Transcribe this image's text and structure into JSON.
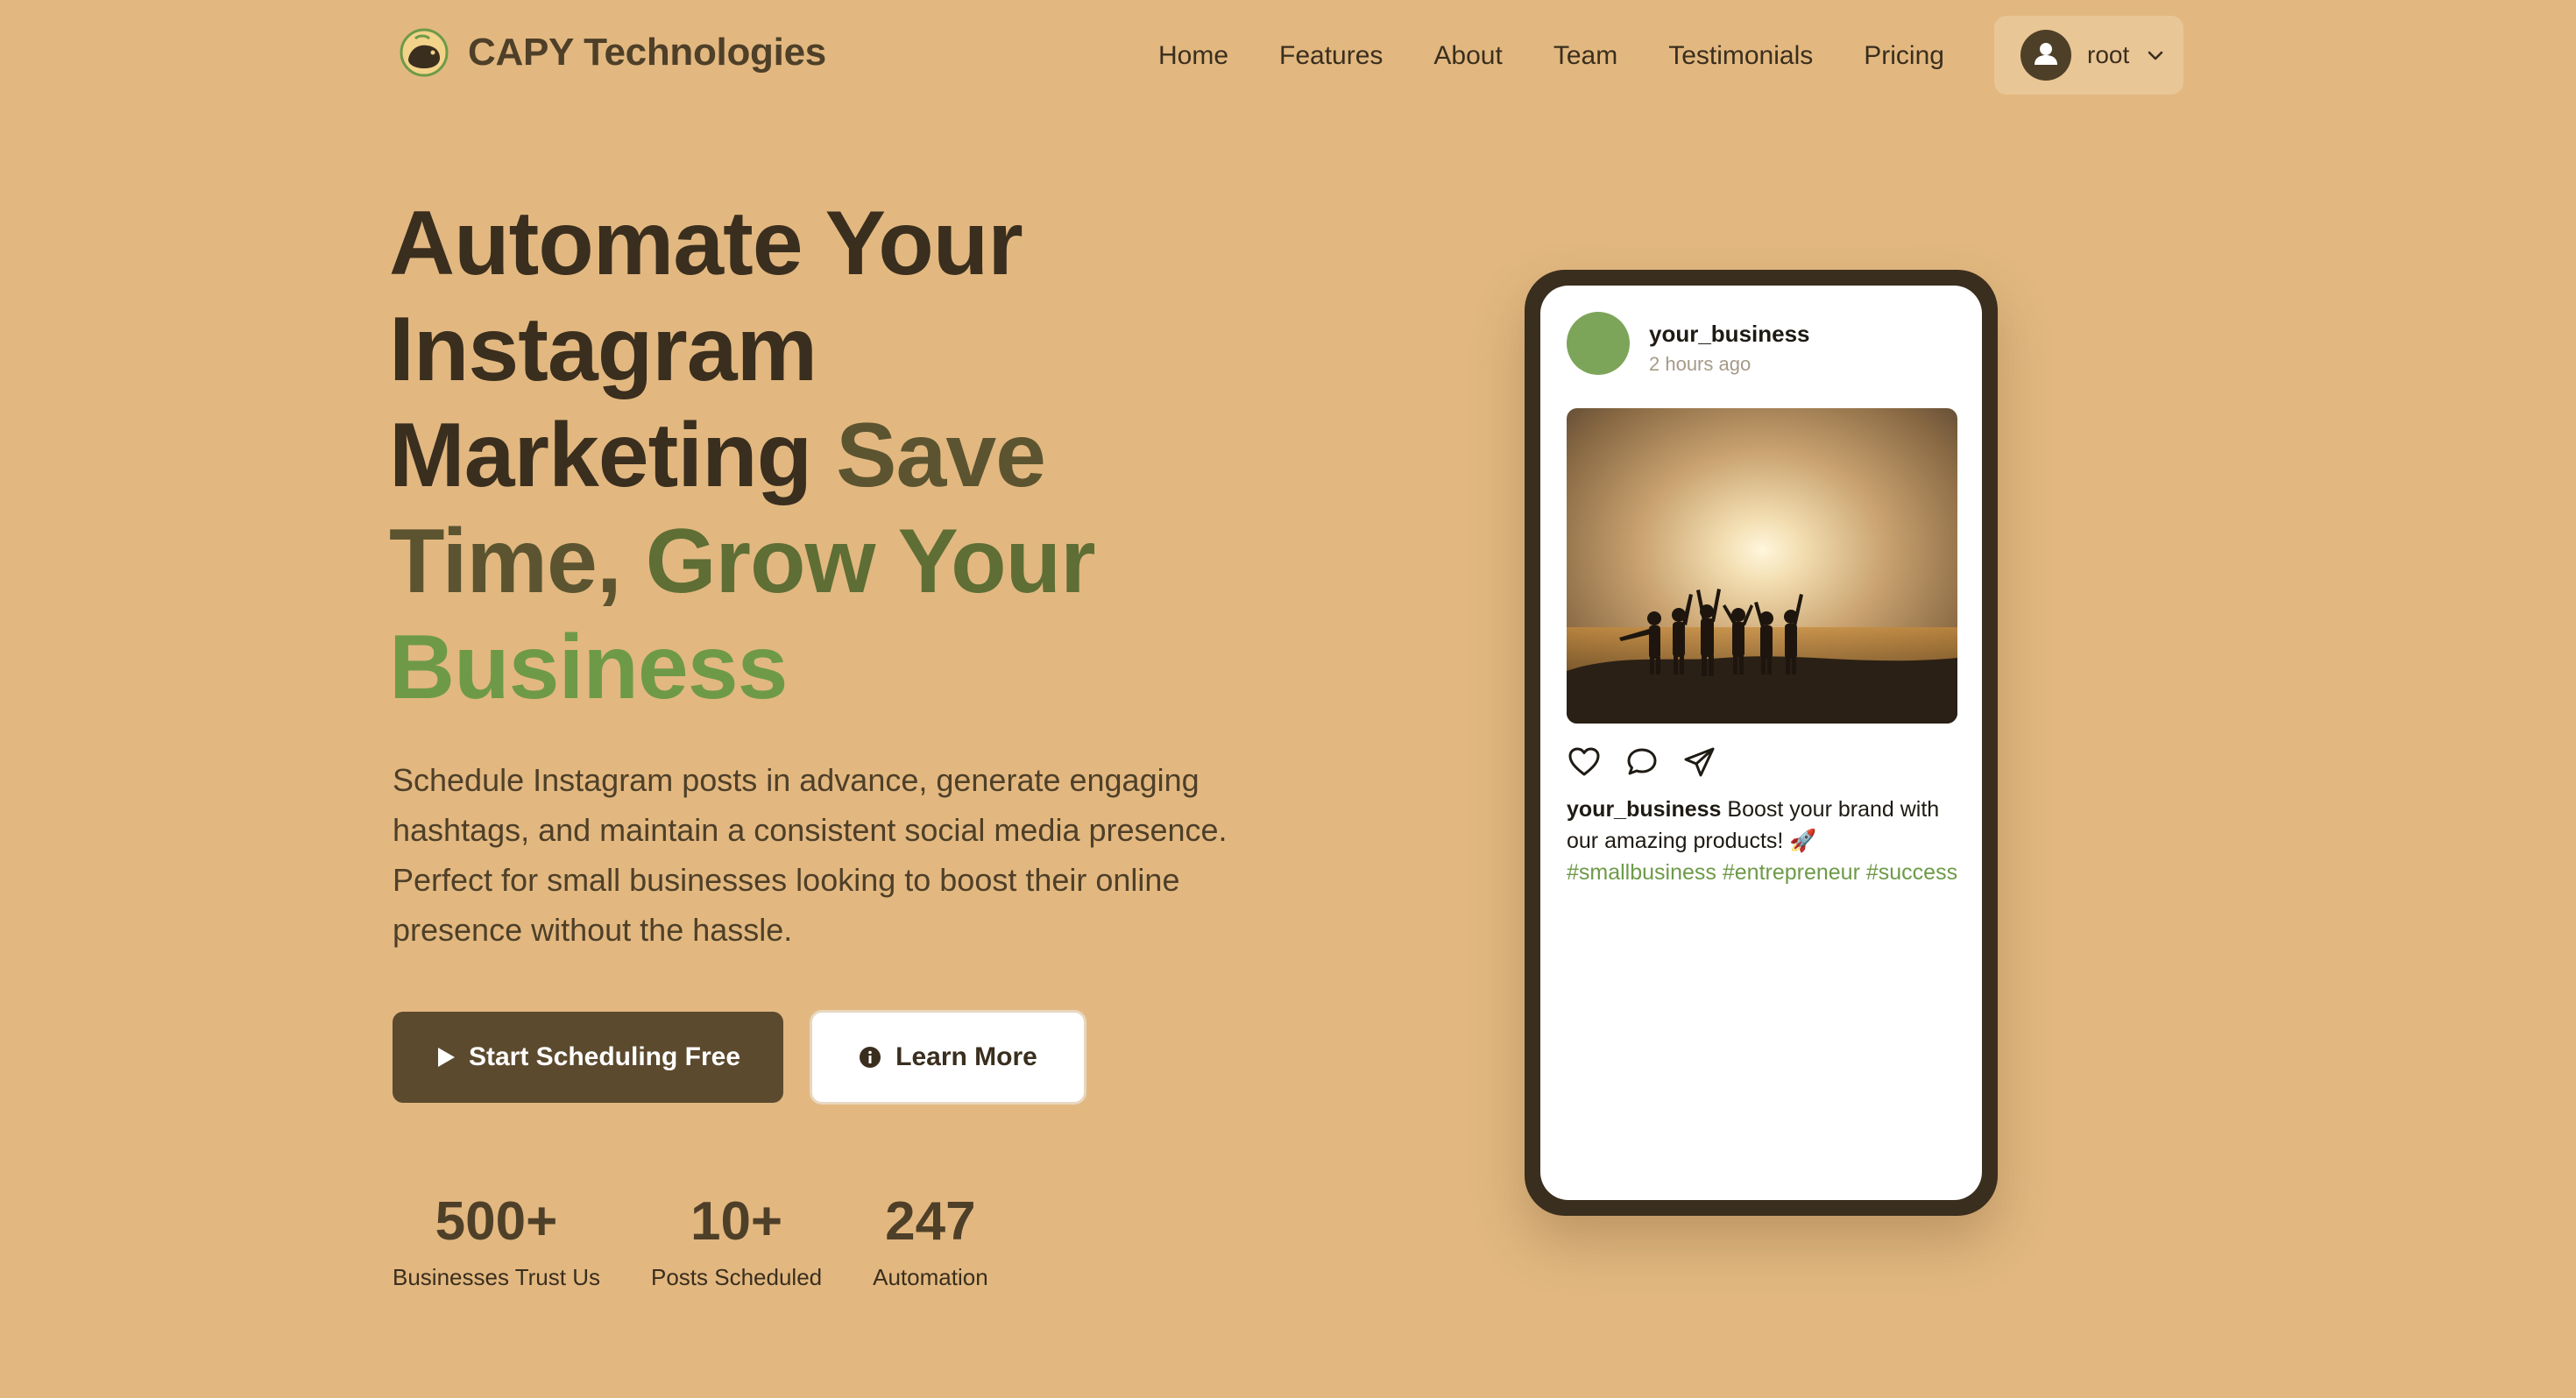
{
  "brand": {
    "name": "CAPY Technologies",
    "logo_icon": "capybara-logo-icon"
  },
  "nav": {
    "links": [
      "Home",
      "Features",
      "About",
      "Team",
      "Testimonials",
      "Pricing"
    ],
    "user": {
      "name": "root",
      "avatar_icon": "user-avatar-icon",
      "dropdown_icon": "chevron-down-icon"
    }
  },
  "hero": {
    "title_parts": [
      {
        "text": "Automate Your Instagram Marketing ",
        "style": "dark"
      },
      {
        "text": "Save Time, ",
        "style": "mid"
      },
      {
        "text": "Grow Your ",
        "style": "olive"
      },
      {
        "text": "Business",
        "style": "green"
      }
    ],
    "subtitle": "Schedule Instagram posts in advance, generate engaging hashtags, and maintain a consistent social media presence. Perfect for small businesses looking to boost their online presence without the hassle.",
    "primary_button": {
      "label": "Start Scheduling Free",
      "icon": "play-icon"
    },
    "secondary_button": {
      "label": "Learn More",
      "icon": "info-icon"
    }
  },
  "stats": [
    {
      "value": "500+",
      "label": "Businesses Trust Us"
    },
    {
      "value": "10+",
      "label": "Posts Scheduled"
    },
    {
      "value": "247",
      "label": "Automation"
    }
  ],
  "post": {
    "username": "your_business",
    "time": "2 hours ago",
    "image_icon": "sunset-group-photo",
    "actions": [
      "heart-icon",
      "comment-icon",
      "send-icon"
    ],
    "caption_user": "your_business",
    "caption_text": " Boost your brand with our amazing products! 🚀",
    "hashtags": "#smallbusiness #entrepreneur #success"
  },
  "colors": {
    "background": "#E2B880",
    "dark": "#3A2E1E",
    "brown": "#5C4A2E",
    "olive": "#5E6E35",
    "green": "#6E9A48"
  }
}
